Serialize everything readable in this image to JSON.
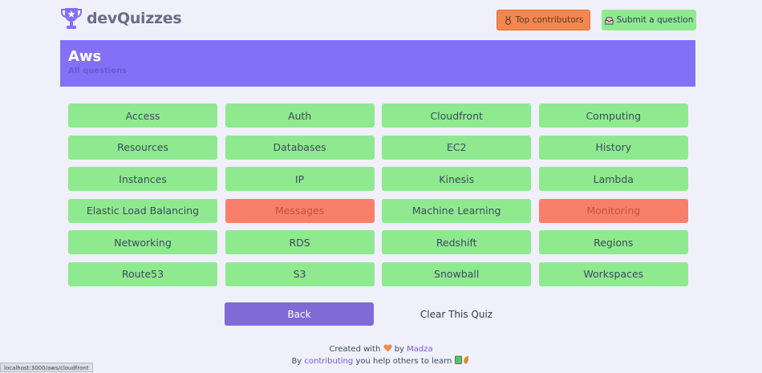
{
  "app": {
    "title": "devQuizzes"
  },
  "header": {
    "top_contributors_label": "Top contributors",
    "submit_question_label": "Submit a question"
  },
  "banner": {
    "title": "Aws",
    "subtitle": "All questions"
  },
  "topics": [
    {
      "label": "Access",
      "status": "normal"
    },
    {
      "label": "Auth",
      "status": "normal"
    },
    {
      "label": "Cloudfront",
      "status": "normal"
    },
    {
      "label": "Computing",
      "status": "normal"
    },
    {
      "label": "Resources",
      "status": "normal"
    },
    {
      "label": "Databases",
      "status": "normal"
    },
    {
      "label": "EC2",
      "status": "normal"
    },
    {
      "label": "History",
      "status": "normal"
    },
    {
      "label": "Instances",
      "status": "normal"
    },
    {
      "label": "IP",
      "status": "normal"
    },
    {
      "label": "Kinesis",
      "status": "normal"
    },
    {
      "label": "Lambda",
      "status": "normal"
    },
    {
      "label": "Elastic Load Balancing",
      "status": "normal"
    },
    {
      "label": "Messages",
      "status": "wrong"
    },
    {
      "label": "Machine Learning",
      "status": "normal"
    },
    {
      "label": "Monitoring",
      "status": "wrong"
    },
    {
      "label": "Networking",
      "status": "normal"
    },
    {
      "label": "RDS",
      "status": "normal"
    },
    {
      "label": "Redshift",
      "status": "normal"
    },
    {
      "label": "Regions",
      "status": "normal"
    },
    {
      "label": "Route53",
      "status": "normal"
    },
    {
      "label": "S3",
      "status": "normal"
    },
    {
      "label": "Snowball",
      "status": "normal"
    },
    {
      "label": "Workspaces",
      "status": "normal"
    }
  ],
  "actions": {
    "back_label": "Back",
    "clear_label": "Clear This Quiz"
  },
  "footer": {
    "created_with": "Created with",
    "by": "by",
    "author": "Madza",
    "by_prefix": "By",
    "contributing": "contributing",
    "help_text": "you help others to learn"
  },
  "status_bar": {
    "url": "localhost:3000/aws/cloudfront"
  },
  "colors": {
    "background": "#f0f0fb",
    "banner": "#8470f7",
    "tile": "#8fea8f",
    "tile_wrong": "#f97f6a",
    "contributors_button": "#f4874f",
    "back_button": "#7f6ad6"
  },
  "icons": {
    "logo": "trophy-star-icon",
    "contributors": "medal-icon",
    "submit": "inbox-icon",
    "heart": "heart-icon",
    "footer_emoji": "books-sprout-icon"
  }
}
